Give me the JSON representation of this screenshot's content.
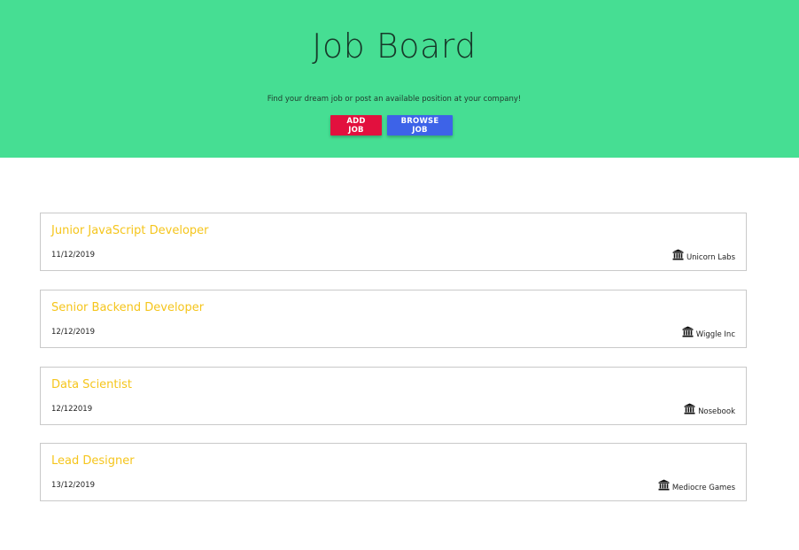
{
  "hero": {
    "title": "Job Board",
    "subtitle": "Find your dream job or post an available position at your company!",
    "add_label": "ADD JOB",
    "browse_label": "BROWSE JOB",
    "background": "#46de93",
    "add_color": "#e2103e",
    "browse_color": "#3d63e8"
  },
  "jobs": [
    {
      "title": "Junior JavaScript Developer",
      "date": "11/12/2019",
      "company": "Unicorn Labs",
      "icon": "bank-icon"
    },
    {
      "title": "Senior Backend Developer",
      "date": "12/12/2019",
      "company": "Wiggle Inc",
      "icon": "bank-icon"
    },
    {
      "title": "Data Scientist",
      "date": "12/122019",
      "company": "Nosebook",
      "icon": "bank-icon"
    },
    {
      "title": "Lead Designer",
      "date": "13/12/2019",
      "company": "Mediocre Games",
      "icon": "bank-icon"
    }
  ],
  "colors": {
    "job_title": "#f5c51c"
  }
}
